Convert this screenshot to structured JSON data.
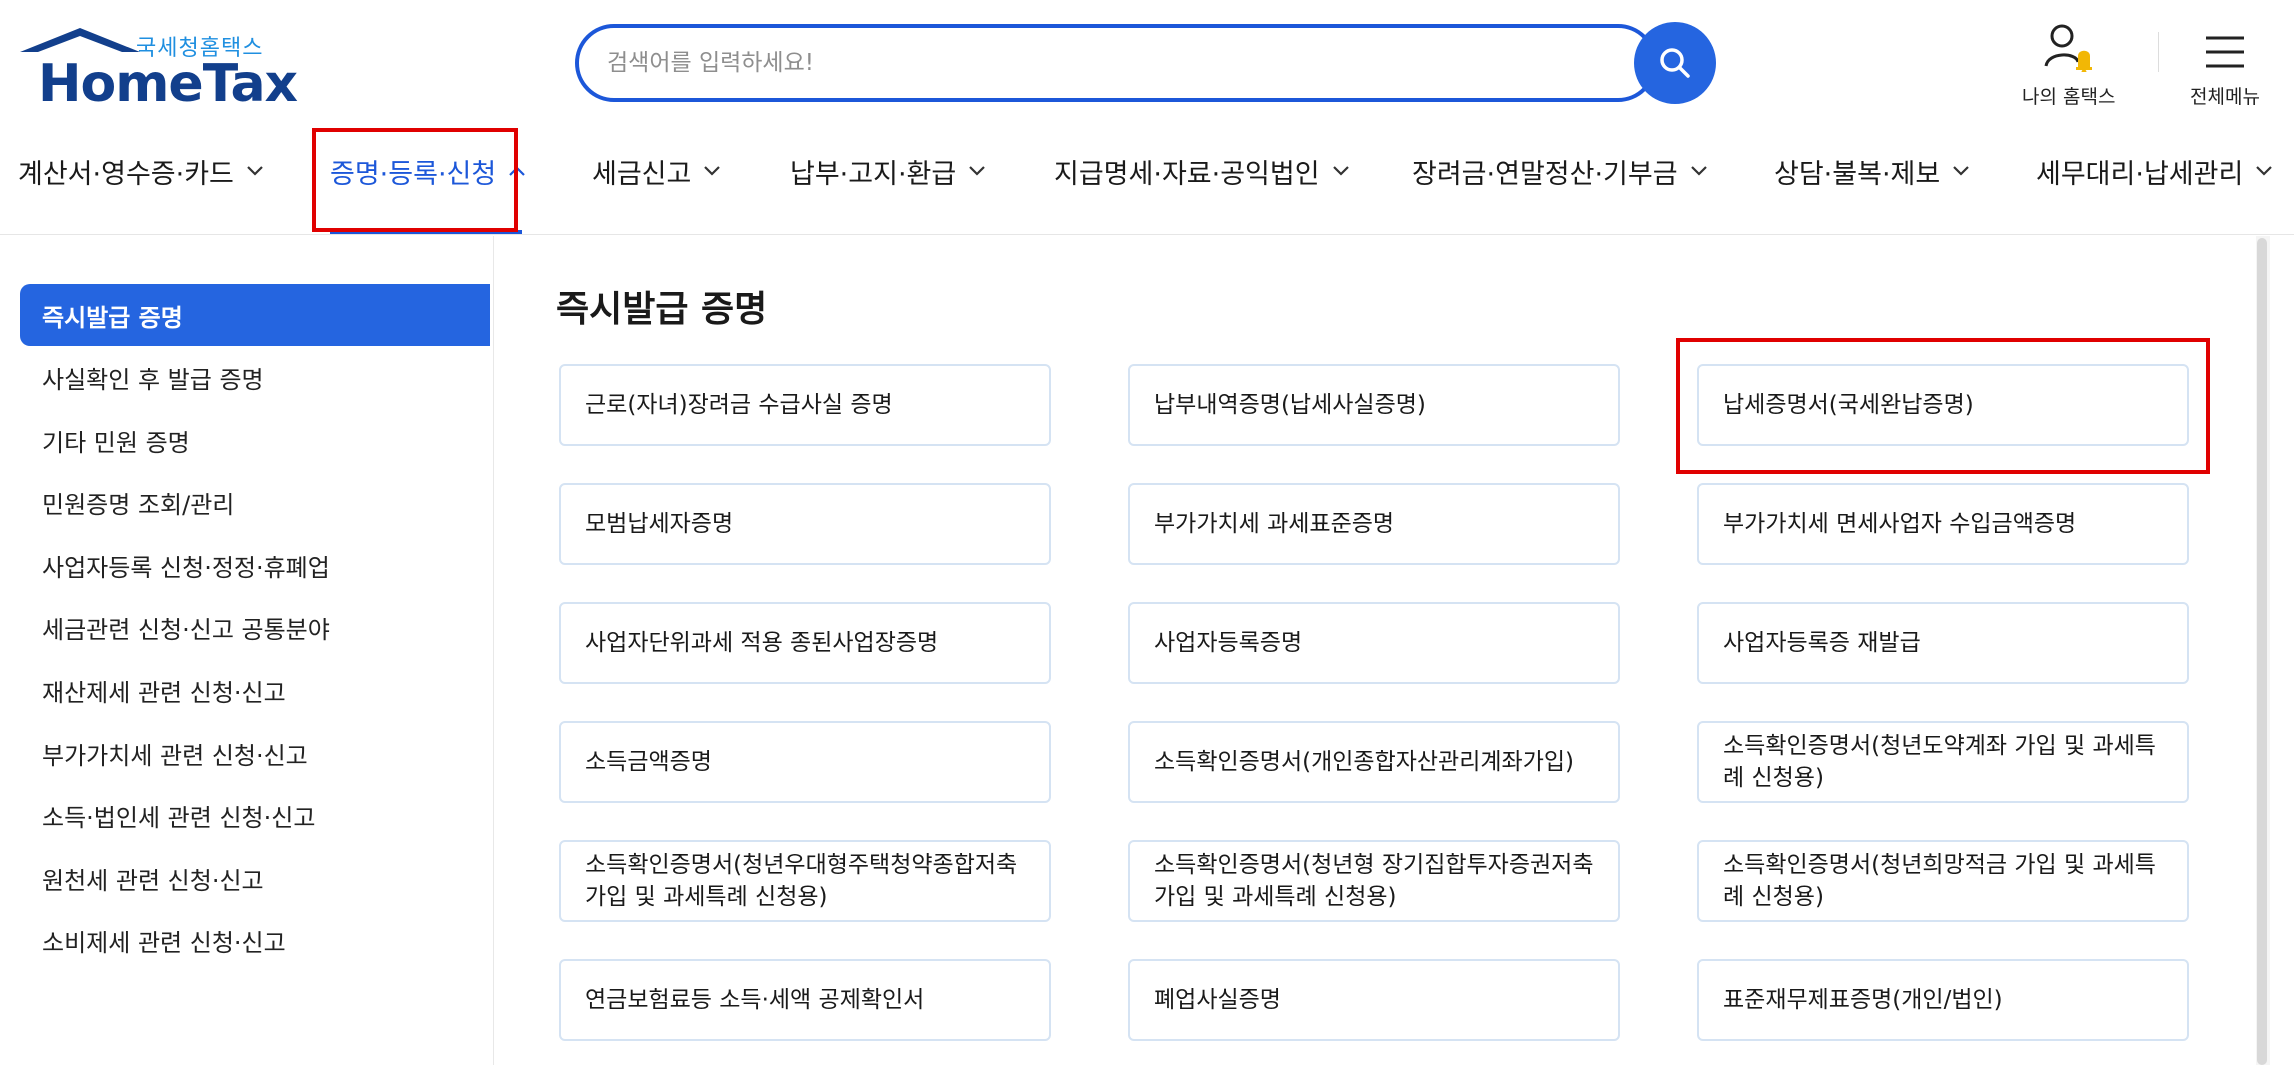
{
  "logo": {
    "subtitle": "국세청홈택스",
    "name": "HomeTax"
  },
  "search": {
    "placeholder": "검색어를 입력하세요!",
    "value": ""
  },
  "utilities": {
    "my_hometax": "나의 홈택스",
    "all_menu": "전체메뉴"
  },
  "gnb": [
    {
      "label": "계산서·영수증·카드"
    },
    {
      "label": "증명·등록·신청"
    },
    {
      "label": "세금신고"
    },
    {
      "label": "납부·고지·환급"
    },
    {
      "label": "지급명세·자료·공익법인"
    },
    {
      "label": "장려금·연말정산·기부금"
    },
    {
      "label": "상담·불복·제보"
    },
    {
      "label": "세무대리·납세관리"
    }
  ],
  "sidebar": {
    "items": [
      {
        "label": "즉시발급 증명"
      },
      {
        "label": "사실확인 후 발급 증명"
      },
      {
        "label": "기타 민원 증명"
      },
      {
        "label": "민원증명 조회/관리"
      },
      {
        "label": "사업자등록 신청·정정·휴폐업"
      },
      {
        "label": "세금관련 신청·신고 공통분야"
      },
      {
        "label": "재산제세 관련 신청·신고"
      },
      {
        "label": "부가가치세 관련 신청·신고"
      },
      {
        "label": "소득·법인세 관련 신청·신고"
      },
      {
        "label": "원천세 관련 신청·신고"
      },
      {
        "label": "소비제세 관련 신청·신고"
      }
    ]
  },
  "main": {
    "title": "즉시발급 증명",
    "cards": [
      {
        "label": "근로(자녀)장려금 수급사실 증명"
      },
      {
        "label": "납부내역증명(납세사실증명)"
      },
      {
        "label": "납세증명서(국세완납증명)"
      },
      {
        "label": "모범납세자증명"
      },
      {
        "label": "부가가치세 과세표준증명"
      },
      {
        "label": "부가가치세 면세사업자 수입금액증명"
      },
      {
        "label": "사업자단위과세 적용 종된사업장증명"
      },
      {
        "label": "사업자등록증명"
      },
      {
        "label": "사업자등록증 재발급"
      },
      {
        "label": "소득금액증명"
      },
      {
        "label": "소득확인증명서(개인종합자산관리계좌가입)"
      },
      {
        "label": "소득확인증명서(청년도약계좌 가입 및 과세특례 신청용)"
      },
      {
        "label": "소득확인증명서(청년우대형주택청약종합저축 가입 및 과세특례 신청용)"
      },
      {
        "label": "소득확인증명서(청년형 장기집합투자증권저축 가입 및 과세특례 신청용)"
      },
      {
        "label": "소득확인증명서(청년희망적금 가입 및 과세특례 신청용)"
      },
      {
        "label": "연금보험료등 소득·세액 공제확인서"
      },
      {
        "label": "폐업사실증명"
      },
      {
        "label": "표준재무제표증명(개인/법인)"
      }
    ]
  },
  "colors": {
    "accent": "#2565e0",
    "brand_dark": "#123f8c",
    "highlight": "#e00000",
    "card_border": "#d5e3f3"
  }
}
